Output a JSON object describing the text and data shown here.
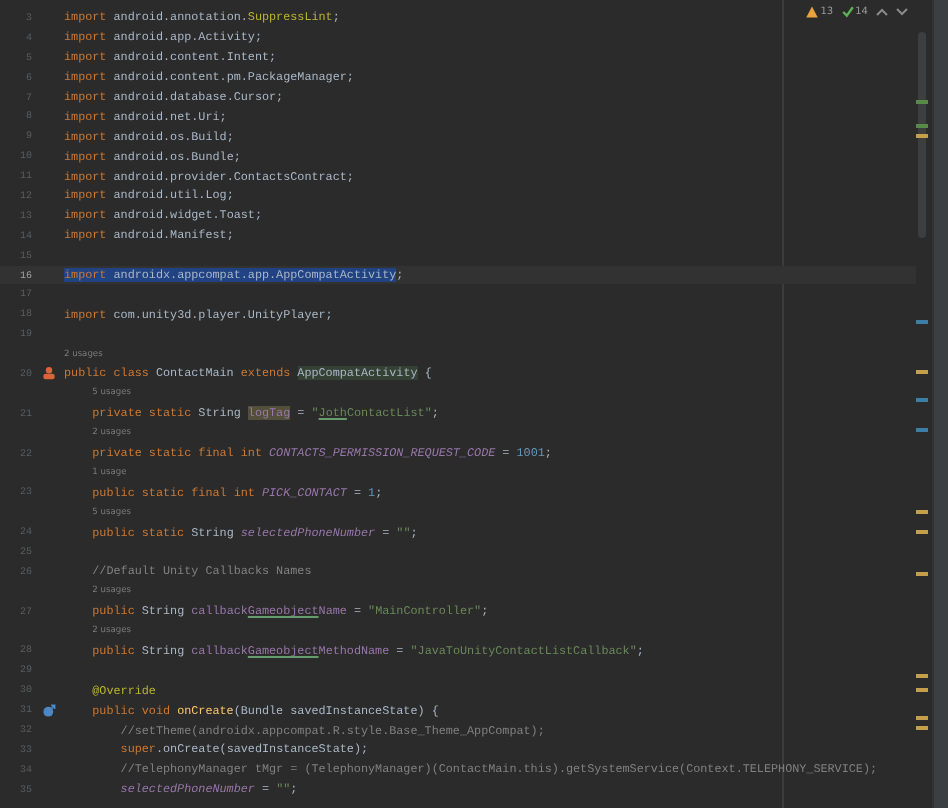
{
  "inspections": [
    {
      "kind": "warning",
      "count": "13"
    },
    {
      "kind": "typo",
      "count": "14"
    }
  ],
  "lines": [
    {
      "number": "3",
      "selected": false,
      "tokens": [
        {
          "kind": "keyword",
          "text": "import"
        },
        {
          "kind": "plain",
          "text": " android.annotation."
        },
        {
          "kind": "annotation",
          "text": "SuppressLint"
        },
        {
          "kind": "plain",
          "text": ";"
        }
      ]
    },
    {
      "number": "4",
      "selected": false,
      "tokens": [
        {
          "kind": "keyword",
          "text": "import"
        },
        {
          "kind": "plain",
          "text": " android.app.Activity;"
        }
      ]
    },
    {
      "number": "5",
      "selected": false,
      "tokens": [
        {
          "kind": "keyword",
          "text": "import"
        },
        {
          "kind": "plain",
          "text": " android.content.Intent;"
        }
      ]
    },
    {
      "number": "6",
      "selected": false,
      "tokens": [
        {
          "kind": "keyword",
          "text": "import"
        },
        {
          "kind": "plain",
          "text": " android.content.pm.PackageManager;"
        }
      ]
    },
    {
      "number": "7",
      "selected": false,
      "tokens": [
        {
          "kind": "keyword",
          "text": "import"
        },
        {
          "kind": "plain",
          "text": " android.database.Cursor;"
        }
      ]
    },
    {
      "number": "8",
      "selected": false,
      "tokens": [
        {
          "kind": "keyword",
          "text": "import"
        },
        {
          "kind": "plain",
          "text": " android.net.Uri;"
        }
      ]
    },
    {
      "number": "9",
      "selected": false,
      "tokens": [
        {
          "kind": "keyword",
          "text": "import"
        },
        {
          "kind": "plain",
          "text": " android.os.Build;"
        }
      ]
    },
    {
      "number": "10",
      "selected": false,
      "tokens": [
        {
          "kind": "keyword",
          "text": "import"
        },
        {
          "kind": "plain",
          "text": " android.os.Bundle;"
        }
      ]
    },
    {
      "number": "11",
      "selected": false,
      "tokens": [
        {
          "kind": "keyword",
          "text": "import"
        },
        {
          "kind": "plain",
          "text": " android.provider.ContactsContract;"
        }
      ]
    },
    {
      "number": "12",
      "selected": false,
      "tokens": [
        {
          "kind": "keyword",
          "text": "import"
        },
        {
          "kind": "plain",
          "text": " android.util.Log;"
        }
      ]
    },
    {
      "number": "13",
      "selected": false,
      "tokens": [
        {
          "kind": "keyword",
          "text": "import"
        },
        {
          "kind": "plain",
          "text": " android.widget.Toast;"
        }
      ]
    },
    {
      "number": "14",
      "selected": false,
      "tokens": [
        {
          "kind": "keyword",
          "text": "import"
        },
        {
          "kind": "plain",
          "text": " android.Manifest;"
        }
      ]
    },
    {
      "number": "15",
      "selected": false
    },
    {
      "number": "16",
      "selected": true,
      "tokens": [
        {
          "kind": "keyword",
          "text": "import"
        },
        {
          "kind": "plain",
          "text": " androidx.appcompat.app.AppCompatActivity"
        },
        {
          "kind": "plain",
          "text": ";"
        }
      ]
    },
    {
      "number": "17",
      "selected": false
    },
    {
      "number": "18",
      "selected": false,
      "tokens": [
        {
          "kind": "keyword",
          "text": "import"
        },
        {
          "kind": "plain",
          "text": " com.unity3d.player.UnityPlayer;"
        }
      ]
    },
    {
      "number": "19",
      "selected": false
    },
    {
      "number": "20",
      "hint": "2 usages",
      "gutter_marker": {
        "kind": "class"
      },
      "selected": false,
      "tokens": [
        {
          "kind": "keyword",
          "text": "public class"
        },
        {
          "kind": "plain",
          "text": " ContactMain "
        },
        {
          "kind": "keyword",
          "text": "extends "
        },
        {
          "kind": "marked",
          "text": "AppCompatActivity"
        },
        {
          "kind": "plain",
          "text": " {"
        }
      ]
    },
    {
      "number": "21",
      "hint": "5 usages",
      "selected": false,
      "tokens": [
        {
          "kind": "keyword",
          "text": "    private static"
        },
        {
          "kind": "plain",
          "text": " String "
        },
        {
          "kind": "marked_field",
          "text": "logTag"
        },
        {
          "kind": "plain",
          "text": " = "
        },
        {
          "kind": "string",
          "text": "\""
        },
        {
          "kind": "string_typo",
          "text": "Joth"
        },
        {
          "kind": "string",
          "text": "ContactList\""
        },
        {
          "kind": "plain",
          "text": ";"
        }
      ]
    },
    {
      "number": "22",
      "hint": "2 usages",
      "selected": false,
      "tokens": [
        {
          "kind": "keyword",
          "text": "    private static final int "
        },
        {
          "kind": "constant",
          "text": "CONTACTS_PERMISSION_REQUEST_CODE"
        },
        {
          "kind": "plain",
          "text": " = "
        },
        {
          "kind": "number",
          "text": "1001"
        },
        {
          "kind": "plain",
          "text": ";"
        }
      ]
    },
    {
      "number": "23",
      "hint": "1 usage",
      "selected": false,
      "tokens": [
        {
          "kind": "keyword",
          "text": "    public static final int "
        },
        {
          "kind": "constant",
          "text": "PICK_CONTACT"
        },
        {
          "kind": "plain",
          "text": " = "
        },
        {
          "kind": "number",
          "text": "1"
        },
        {
          "kind": "plain",
          "text": ";"
        }
      ]
    },
    {
      "number": "24",
      "hint": "5 usages",
      "selected": false,
      "tokens": [
        {
          "kind": "keyword",
          "text": "    public static"
        },
        {
          "kind": "plain",
          "text": " String "
        },
        {
          "kind": "constant",
          "text": "selectedPhoneNumber"
        },
        {
          "kind": "plain",
          "text": " = "
        },
        {
          "kind": "string",
          "text": "\"\""
        },
        {
          "kind": "plain",
          "text": ";"
        }
      ]
    },
    {
      "number": "25",
      "selected": false
    },
    {
      "number": "26",
      "selected": false,
      "tokens": [
        {
          "kind": "comment",
          "text": "    //Default Unity Callbacks Names"
        }
      ]
    },
    {
      "number": "27",
      "hint": "2 usages",
      "selected": false,
      "tokens": [
        {
          "kind": "keyword",
          "text": "    public"
        },
        {
          "kind": "plain",
          "text": " String "
        },
        {
          "kind": "field",
          "text": "callback"
        },
        {
          "kind": "field_typo",
          "text": "Gameobject"
        },
        {
          "kind": "field",
          "text": "Name"
        },
        {
          "kind": "plain",
          "text": " = "
        },
        {
          "kind": "string",
          "text": "\"MainController\""
        },
        {
          "kind": "plain",
          "text": ";"
        }
      ]
    },
    {
      "number": "28",
      "hint": "2 usages",
      "selected": false,
      "tokens": [
        {
          "kind": "keyword",
          "text": "    public"
        },
        {
          "kind": "plain",
          "text": " String "
        },
        {
          "kind": "field",
          "text": "callback"
        },
        {
          "kind": "field_typo",
          "text": "Gameobject"
        },
        {
          "kind": "field",
          "text": "MethodName"
        },
        {
          "kind": "plain",
          "text": " = "
        },
        {
          "kind": "string",
          "text": "\"JavaToUnityContactListCallback\""
        },
        {
          "kind": "plain",
          "text": ";"
        }
      ]
    },
    {
      "number": "29",
      "selected": false
    },
    {
      "number": "30",
      "selected": false,
      "tokens": [
        {
          "kind": "annotation",
          "text": "    @Override"
        }
      ]
    },
    {
      "number": "31",
      "gutter_marker": {
        "kind": "override"
      },
      "selected": false,
      "tokens": [
        {
          "kind": "keyword",
          "text": "    public void "
        },
        {
          "kind": "method",
          "text": "onCreate"
        },
        {
          "kind": "plain",
          "text": "(Bundle savedInstanceState) {"
        }
      ]
    },
    {
      "number": "32",
      "selected": false,
      "tokens": [
        {
          "kind": "comment",
          "text": "        //setTheme(androidx.appcompat.R.style.Base_Theme_AppCompat);"
        }
      ]
    },
    {
      "number": "33",
      "selected": false,
      "tokens": [
        {
          "kind": "keyword",
          "text": "        super"
        },
        {
          "kind": "plain",
          "text": ".onCreate(savedInstanceState);"
        }
      ]
    },
    {
      "number": "34",
      "selected": false,
      "tokens": [
        {
          "kind": "comment",
          "text": "        //TelephonyManager tMgr = (TelephonyManager)(ContactMain.this).getSystemService(Context.TELEPHONY_SERVICE);"
        }
      ]
    },
    {
      "number": "35",
      "selected": false,
      "tokens": [
        {
          "kind": "constant",
          "text": "        selectedPhoneNumber"
        },
        {
          "kind": "plain",
          "text": " = "
        },
        {
          "kind": "string",
          "text": "\"\""
        },
        {
          "kind": "plain",
          "text": ";"
        }
      ]
    }
  ]
}
